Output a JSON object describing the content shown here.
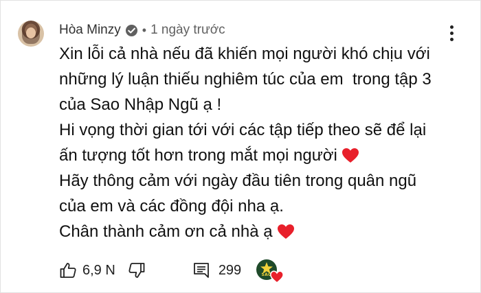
{
  "comment": {
    "author": "Hòa Minzy",
    "separator": "•",
    "time": "1 ngày trước",
    "lines": [
      "Xin lỗi cả nhà nếu đã khiến mọi người khó chịu với",
      "những lý luận thiếu nghiêm túc của em  trong tập 3",
      "của Sao Nhập Ngũ ạ !",
      "Hi vọng thời gian tới với các tập tiếp theo sẽ để lại",
      "ấn tượng tốt hơn trong mắt mọi người",
      "Hãy thông cảm với ngày đầu tiên trong quân ngũ",
      "của em và các đồng đội nha ạ.",
      "Chân thành cảm ơn cả nhà ạ"
    ],
    "like_count": "6,9 N",
    "reply_count": "299",
    "creator_badge_text": "SAO"
  },
  "icons": {
    "verified": "verified-check-icon",
    "menu": "more-vert-icon",
    "like": "thumb-up-icon",
    "dislike": "thumb-down-icon",
    "replies": "comment-icon",
    "heart": "heart-icon"
  },
  "colors": {
    "heart": "#e8202b",
    "creator_disc": "#1f4a2a",
    "text": "#0f0f0f",
    "meta": "#606060"
  }
}
